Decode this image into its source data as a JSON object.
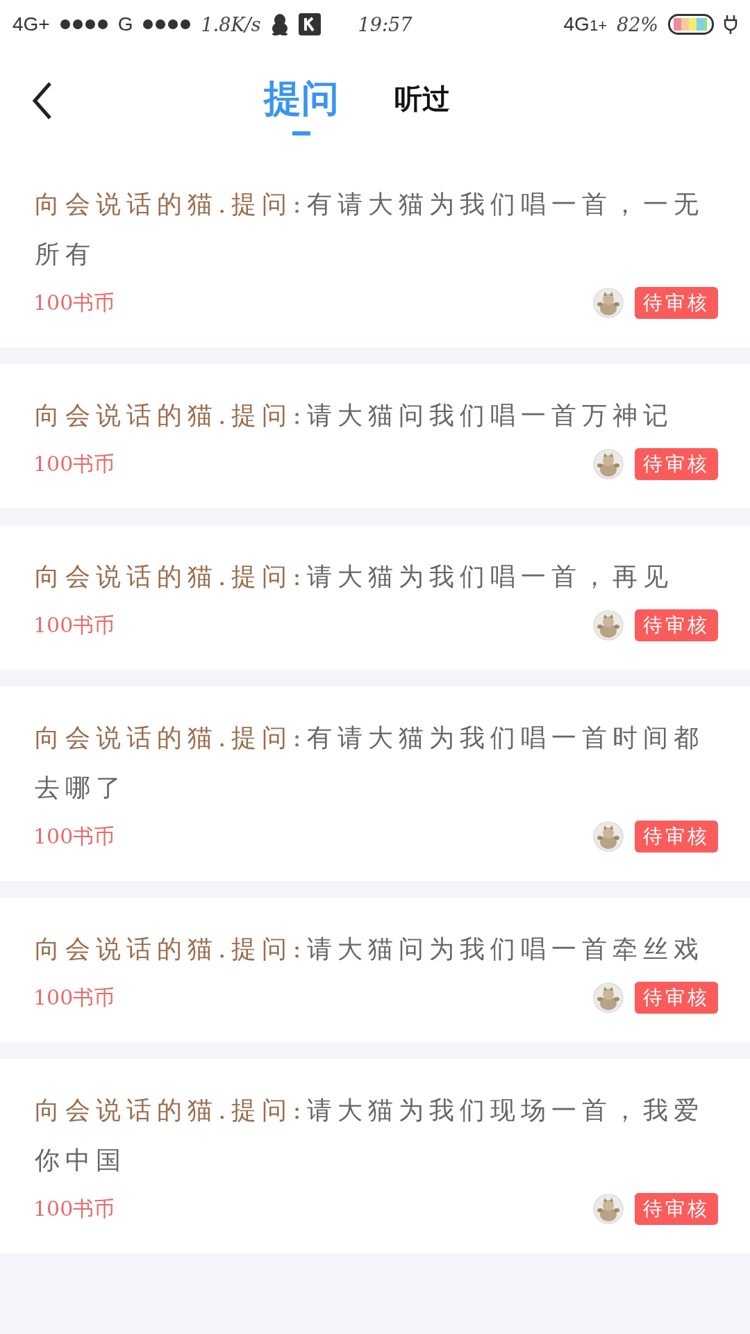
{
  "status_bar": {
    "left_network": "4G+",
    "left_network_2": "G",
    "speed": "1.8K/s",
    "time": "19:57",
    "right_network": "4G",
    "right_network_sub": "1+",
    "battery": "82%"
  },
  "tabs": [
    {
      "label": "提问",
      "selected": true
    },
    {
      "label": "听过",
      "selected": false
    }
  ],
  "questions": [
    {
      "prefix": "向会说话的猫.提问:",
      "text": "有请大猫为我们唱一首，一无所有",
      "price": "100书币",
      "status": "待审核"
    },
    {
      "prefix": "向会说话的猫.提问:",
      "text": "请大猫问我们唱一首万神记",
      "price": "100书币",
      "status": "待审核"
    },
    {
      "prefix": "向会说话的猫.提问:",
      "text": "请大猫为我们唱一首，再见",
      "price": "100书币",
      "status": "待审核"
    },
    {
      "prefix": "向会说话的猫.提问:",
      "text": "有请大猫为我们唱一首时间都去哪了",
      "price": "100书币",
      "status": "待审核"
    },
    {
      "prefix": "向会说话的猫.提问:",
      "text": "请大猫问为我们唱一首牵丝戏",
      "price": "100书币",
      "status": "待审核"
    },
    {
      "prefix": "向会说话的猫.提问:",
      "text": "请大猫为我们现场一首，我爱你中国",
      "price": "100书币",
      "status": "待审核"
    }
  ]
}
